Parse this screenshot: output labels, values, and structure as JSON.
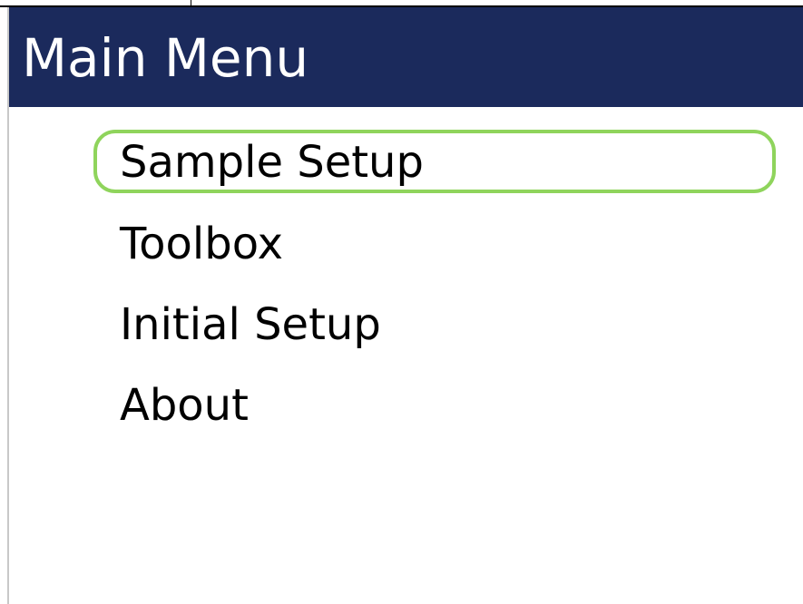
{
  "header": {
    "title": "Main Menu"
  },
  "menu": {
    "selected_index": 0,
    "items": [
      {
        "label": "Sample Setup"
      },
      {
        "label": "Toolbox"
      },
      {
        "label": "Initial Setup"
      },
      {
        "label": "About"
      }
    ]
  },
  "colors": {
    "header_background": "#1b2a5c",
    "header_text": "#ffffff",
    "selection_outline": "#8fd45c",
    "item_text": "#000000"
  }
}
